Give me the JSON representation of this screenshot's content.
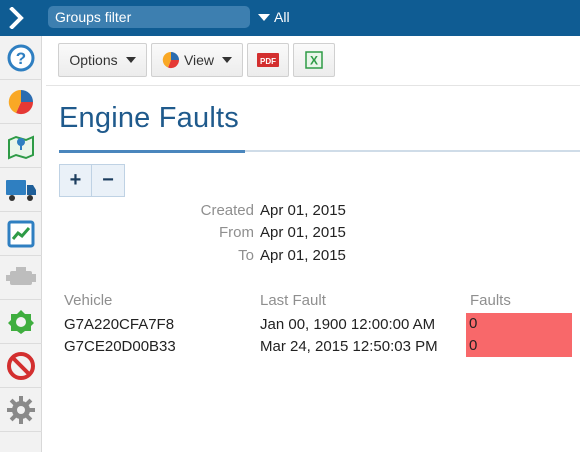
{
  "topbar": {
    "groups_filter_placeholder": "Groups filter",
    "all_label": "All"
  },
  "sidebar": {
    "items": [
      {
        "icon": "help-icon"
      },
      {
        "icon": "pie-chart-icon"
      },
      {
        "icon": "map-icon"
      },
      {
        "icon": "truck-icon"
      },
      {
        "icon": "activity-chart-icon"
      },
      {
        "icon": "engine-icon"
      },
      {
        "icon": "rules-gear-icon"
      },
      {
        "icon": "exceptions-icon"
      },
      {
        "icon": "settings-icon"
      }
    ]
  },
  "toolbar": {
    "options_label": "Options",
    "view_label": "View",
    "pdf_label": "PDF",
    "excel_label": "X"
  },
  "page": {
    "title": "Engine Faults",
    "zoom_in": "+",
    "zoom_out": "−"
  },
  "meta": {
    "created_label": "Created",
    "created_value": "Apr 01, 2015",
    "from_label": "From",
    "from_value": "Apr 01, 2015",
    "to_label": "To",
    "to_value": "Apr 01, 2015"
  },
  "table": {
    "headers": [
      "Vehicle",
      "Last Fault",
      "Faults"
    ],
    "rows": [
      {
        "vehicle": "G7A220CFA7F8",
        "last_fault": "Jan 00, 1900 12:00:00 AM",
        "faults": "0"
      },
      {
        "vehicle": "G7CE20D00B33",
        "last_fault": "Mar 24, 2015 12:50:03 PM",
        "faults": "0"
      }
    ]
  },
  "colors": {
    "topbar": "#0f5c93",
    "title": "#1f5a8c",
    "fault_highlight": "#f8686a"
  }
}
